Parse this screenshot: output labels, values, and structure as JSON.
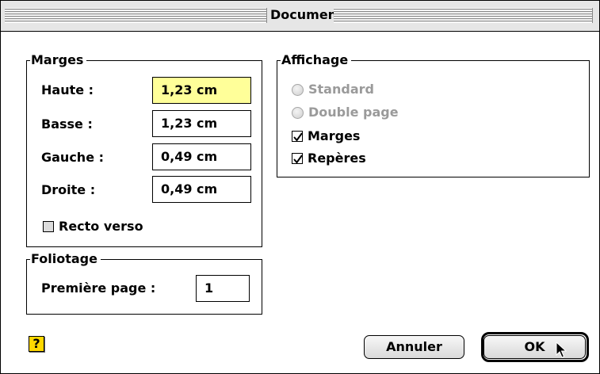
{
  "window": {
    "title": "Document"
  },
  "margins": {
    "legend": "Marges",
    "fields": [
      {
        "label": "Haute :",
        "value": "1,23 cm"
      },
      {
        "label": "Basse :",
        "value": "1,23 cm"
      },
      {
        "label": "Gauche :",
        "value": "0,49 cm"
      },
      {
        "label": "Droite :",
        "value": "0,49 cm"
      }
    ],
    "recto_verso": {
      "label": "Recto verso",
      "checked": false
    }
  },
  "display": {
    "legend": "Affichage",
    "radios": [
      {
        "label": "Standard",
        "enabled": false
      },
      {
        "label": "Double page",
        "enabled": false
      }
    ],
    "checks": [
      {
        "label": "Marges",
        "checked": true
      },
      {
        "label": "Repères",
        "checked": true
      }
    ]
  },
  "foliotage": {
    "legend": "Foliotage",
    "first_page_label": "Première page :",
    "first_page_value": "1"
  },
  "buttons": {
    "help": "?",
    "cancel": "Annuler",
    "ok": "OK"
  },
  "colors": {
    "active_field": "#ffff99",
    "help_icon": "#ffd800"
  }
}
